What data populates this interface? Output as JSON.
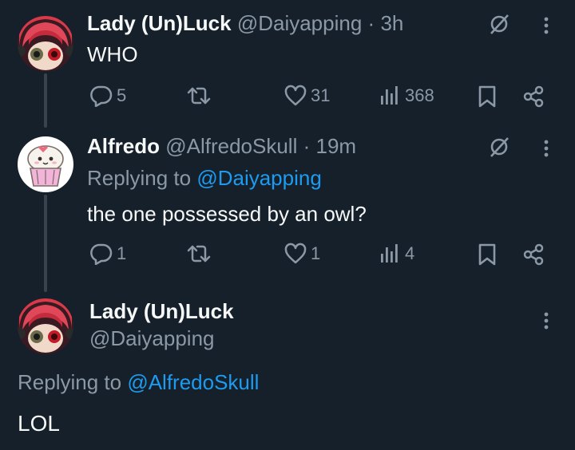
{
  "thread": [
    {
      "display_name": "Lady (Un)Luck",
      "handle": "@Daiyapping",
      "separator": "·",
      "time": "3h",
      "text": "WHO",
      "stats": {
        "replies": "5",
        "likes": "31",
        "views": "368"
      }
    },
    {
      "display_name": "Alfredo",
      "handle": "@AlfredoSkull",
      "separator": "·",
      "time": "19m",
      "replying_prefix": "Replying to",
      "replying_to": "@Daiyapping",
      "text": "the one possessed by an owl?",
      "stats": {
        "replies": "1",
        "likes": "1",
        "views": "4"
      }
    }
  ],
  "focused": {
    "display_name": "Lady (Un)Luck",
    "handle": "@Daiyapping",
    "replying_prefix": "Replying to",
    "replying_to": "@AlfredoSkull",
    "text": "LOL"
  },
  "icons": {
    "reply": "reply-icon",
    "repost": "repost-icon",
    "like": "heart-icon",
    "views": "views-icon",
    "bookmark": "bookmark-icon",
    "share": "share-icon",
    "grok": "grok-icon",
    "more": "more-icon"
  },
  "colors": {
    "background": "#15202b",
    "text_primary": "#f7f9f9",
    "text_secondary": "#8b98a5",
    "accent": "#1d9bf0"
  }
}
